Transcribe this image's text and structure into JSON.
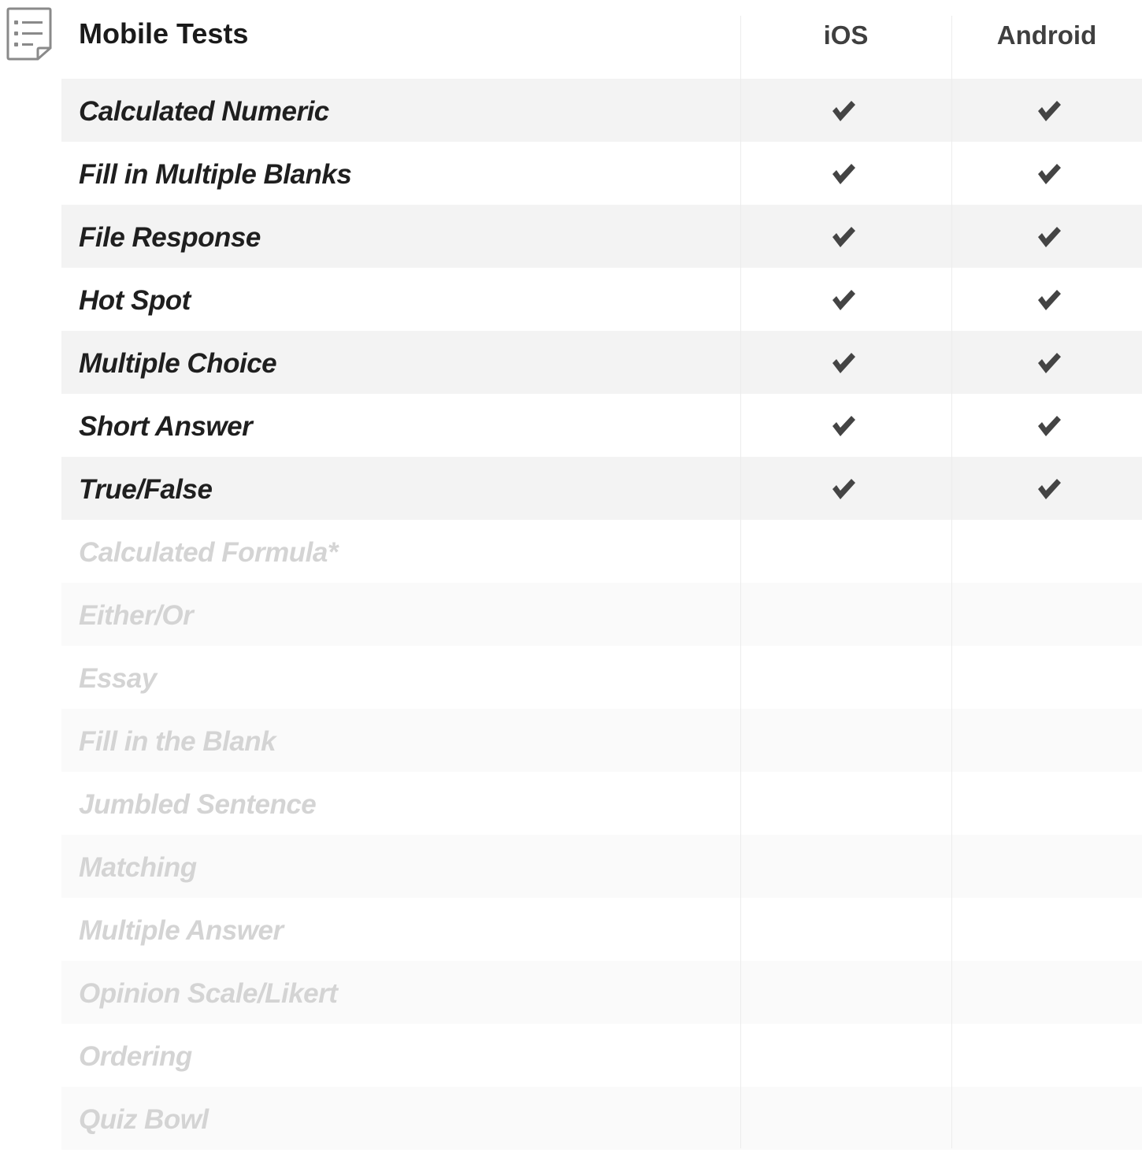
{
  "header": {
    "title": "Mobile Tests",
    "columns": [
      "iOS",
      "Android"
    ]
  },
  "icons": {
    "document": "document-list-icon",
    "check": "checkmark-icon"
  },
  "colors": {
    "shade": "#f3f3f3",
    "shade_inactive": "#fafafa",
    "check": "#444444",
    "inactive_text": "#d4d4d4"
  },
  "rows": [
    {
      "label": "Calculated Numeric",
      "ios": true,
      "android": true,
      "supported": true
    },
    {
      "label": "Fill in Multiple Blanks",
      "ios": true,
      "android": true,
      "supported": true
    },
    {
      "label": "File Response",
      "ios": true,
      "android": true,
      "supported": true
    },
    {
      "label": "Hot Spot",
      "ios": true,
      "android": true,
      "supported": true
    },
    {
      "label": "Multiple Choice",
      "ios": true,
      "android": true,
      "supported": true
    },
    {
      "label": "Short Answer",
      "ios": true,
      "android": true,
      "supported": true
    },
    {
      "label": "True/False",
      "ios": true,
      "android": true,
      "supported": true
    },
    {
      "label": "Calculated Formula*",
      "ios": false,
      "android": false,
      "supported": false
    },
    {
      "label": "Either/Or",
      "ios": false,
      "android": false,
      "supported": false
    },
    {
      "label": "Essay",
      "ios": false,
      "android": false,
      "supported": false
    },
    {
      "label": "Fill in the Blank",
      "ios": false,
      "android": false,
      "supported": false
    },
    {
      "label": "Jumbled Sentence",
      "ios": false,
      "android": false,
      "supported": false
    },
    {
      "label": "Matching",
      "ios": false,
      "android": false,
      "supported": false
    },
    {
      "label": "Multiple Answer",
      "ios": false,
      "android": false,
      "supported": false
    },
    {
      "label": "Opinion Scale/Likert",
      "ios": false,
      "android": false,
      "supported": false
    },
    {
      "label": "Ordering",
      "ios": false,
      "android": false,
      "supported": false
    },
    {
      "label": "Quiz Bowl",
      "ios": false,
      "android": false,
      "supported": false
    }
  ]
}
